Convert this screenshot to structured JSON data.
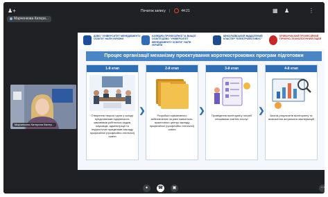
{
  "topbar": {
    "add_person_icon": "person-add-icon",
    "meeting_chip": "Марченкова Катери...",
    "title": "Початок запису",
    "time": "44:21",
    "layout_icon": "layout-icon",
    "people_icon": "people-icon",
    "more_icon": "more-vertical-icon"
  },
  "presentation": {
    "logos": [
      {
        "text": "ДЗВО \"УНІВЕРСИТЕТ МЕНЕДЖМЕНТУ ОСВІТИ\" НАПН УКРАЇНИ",
        "color": "#1c4e9d"
      },
      {
        "text": "КАФЕДРА ПРОФЕСІЙНОЇ ТА ВИЩОЇ ОСВІТИ ДЗВО \"УНІВЕРСИТЕТ МЕНЕДЖМЕНТУ ОСВІТИ\" НАПН УКРАЇНИ",
        "color": "#2f6db5"
      },
      {
        "text": "МИКОЛАЇВСЬКИЙ ВІДДАЛЕНИЙ КЛАСТЕР \"ЕЛЕКТРОМОТИВУС\"",
        "color": "#1d4c8f"
      },
      {
        "text": "КРИВОРІЗЬКИЙ ПРОФЕСІЙНИЙ ГІРНИЧО-ТЕХНОЛОГІЧНИЙ ЛІЦЕЙ",
        "color": "#c62828"
      }
    ],
    "title": "Процес організації механізму проєктування короткострокових програм підготовки",
    "stages": [
      {
        "label": "1-й етап",
        "text": "Створення творчої групи у складі: представників підприємств-замовників робітничих кадрів, науковців, адміністрації та педагогічних працівників закладу професійної (професійно-технічної) освіти"
      },
      {
        "label": "2-й етап",
        "text": "Розробка нормативного забезпечення на рівні навчально-практичного центру закладу професійної (професійно-технічної) освіти"
      },
      {
        "label": "3-й етап",
        "text": "Проведення моніторингу потреб споживачів освітніх послуг"
      },
      {
        "label": "4-й етап",
        "text": "Аналіз результатів моніторингу та визначення актуальних кваліфікацій"
      }
    ]
  },
  "self_tile": {
    "name": "Марченкова Катерина Валер..."
  },
  "controls": {
    "mic_icon": "mic-icon",
    "call_icon": "phone-icon",
    "cam_icon": "camera-icon",
    "more_icon": "more-options-icon"
  }
}
